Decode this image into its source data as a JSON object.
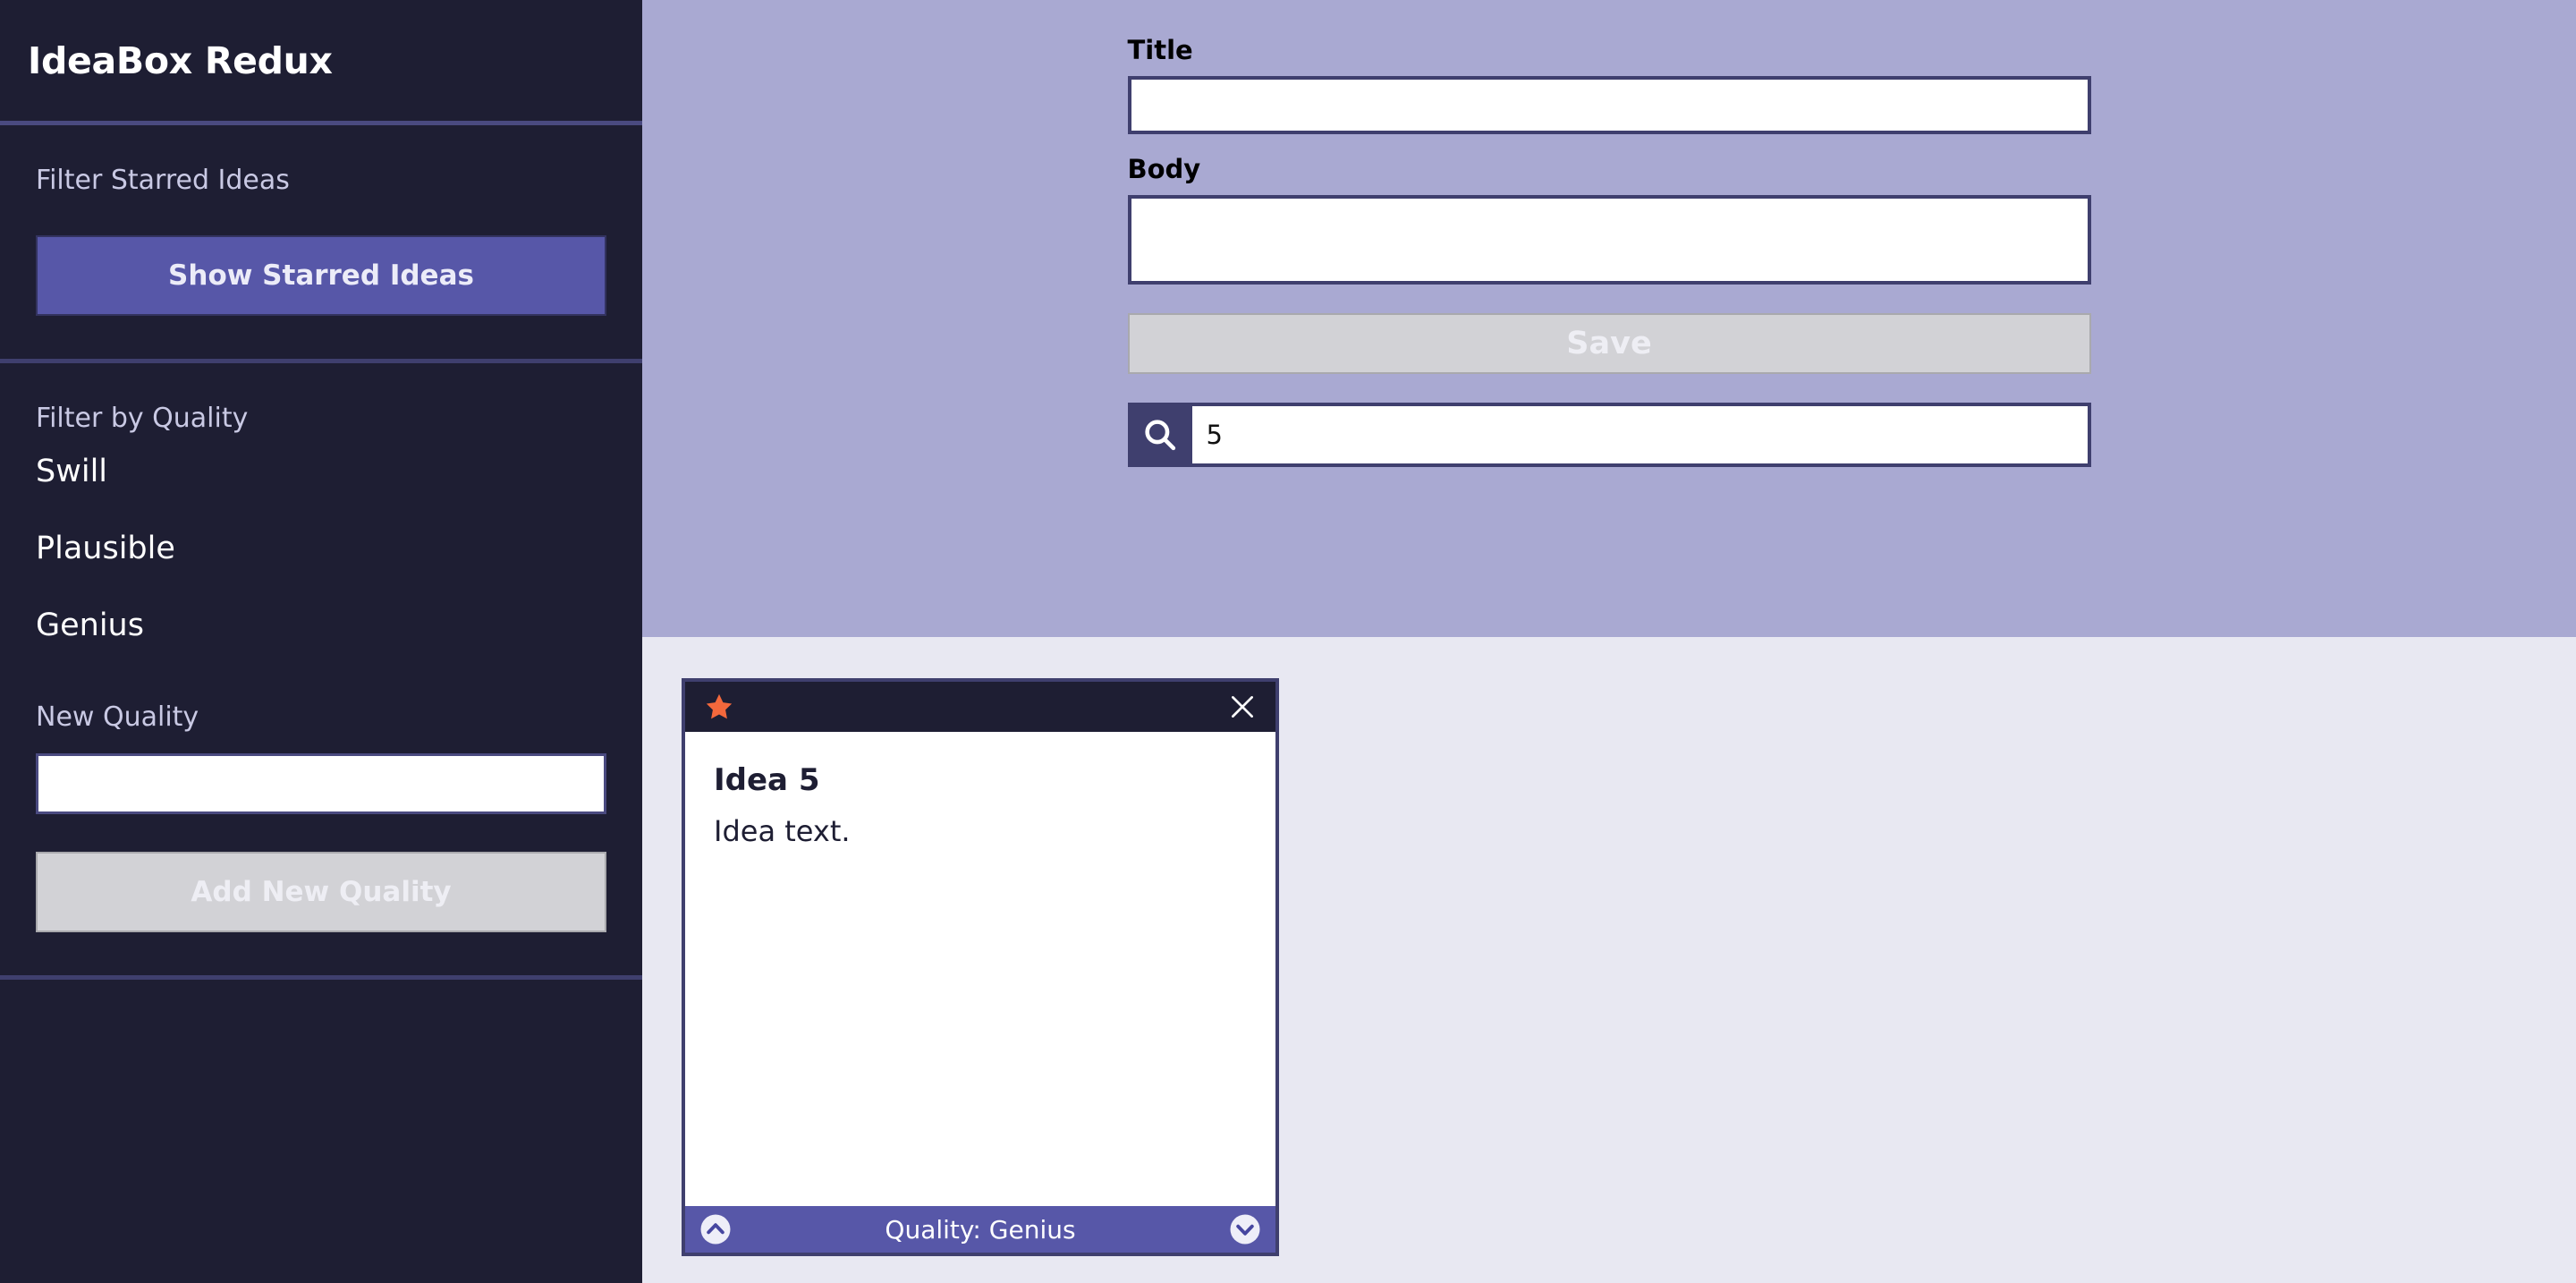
{
  "sidebar": {
    "app_title": "IdeaBox Redux",
    "starred_section": {
      "label": "Filter Starred Ideas",
      "button_label": "Show Starred Ideas"
    },
    "quality_section": {
      "label": "Filter by Quality",
      "qualities": [
        {
          "label": "Swill"
        },
        {
          "label": "Plausible"
        },
        {
          "label": "Genius"
        }
      ],
      "new_quality_label": "New Quality",
      "new_quality_value": "",
      "new_quality_placeholder": "",
      "add_button_label": "Add New Quality"
    }
  },
  "form": {
    "title_label": "Title",
    "title_value": "",
    "title_placeholder": "",
    "body_label": "Body",
    "body_value": "",
    "body_placeholder": "",
    "save_label": "Save",
    "search_icon": "search-icon",
    "search_value": "5",
    "search_placeholder": ""
  },
  "ideas": [
    {
      "star_icon": "star-icon",
      "starred": true,
      "close_icon": "close-icon",
      "title": "Idea 5",
      "body": "Idea text.",
      "quality_label": "Quality: Genius",
      "up_icon": "chevron-up-circle-icon",
      "down_icon": "chevron-down-circle-icon"
    }
  ],
  "colors": {
    "sidebar_bg": "#1e1e33",
    "accent": "#5757a8",
    "form_panel_bg": "#a9a9d2",
    "content_bg": "#e8e8f2",
    "star": "#f4683c",
    "border_dark": "#3f3f6e",
    "disabled_bg": "#d2d2d6"
  }
}
